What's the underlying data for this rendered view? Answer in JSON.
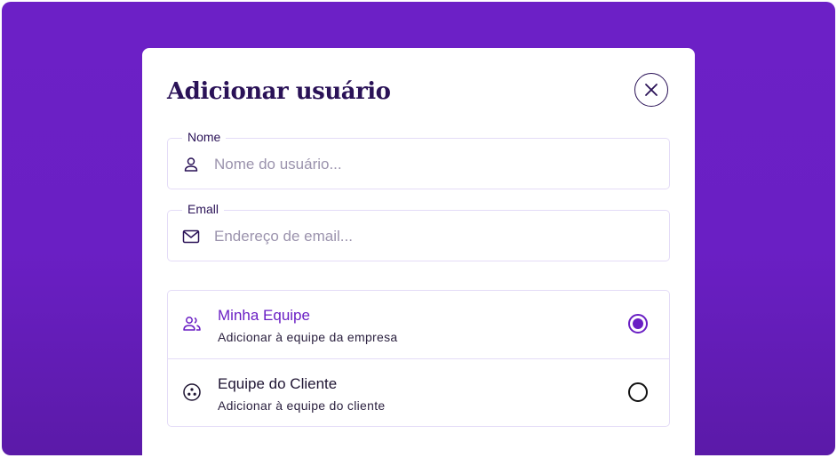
{
  "modal": {
    "title": "Adicionar usuário",
    "close_icon": "close-icon"
  },
  "fields": {
    "name": {
      "label": "Nome",
      "placeholder": "Nome do usuário...",
      "value": "",
      "icon": "user-icon"
    },
    "email": {
      "label": "Emall",
      "placeholder": "Endereço de email...",
      "value": "",
      "icon": "mail-icon"
    }
  },
  "team_options": [
    {
      "title": "Minha Equipe",
      "subtitle": "Adicionar à equipe da empresa",
      "icon": "users-icon",
      "selected": true
    },
    {
      "title": "Equipe do Cliente",
      "subtitle": "Adicionar à equipe do cliente",
      "icon": "client-group-icon",
      "selected": false
    }
  ],
  "colors": {
    "accent": "#6a1fc4",
    "background": "#6c20c6",
    "text_dark": "#2a1257",
    "border": "#e4dcf7"
  }
}
